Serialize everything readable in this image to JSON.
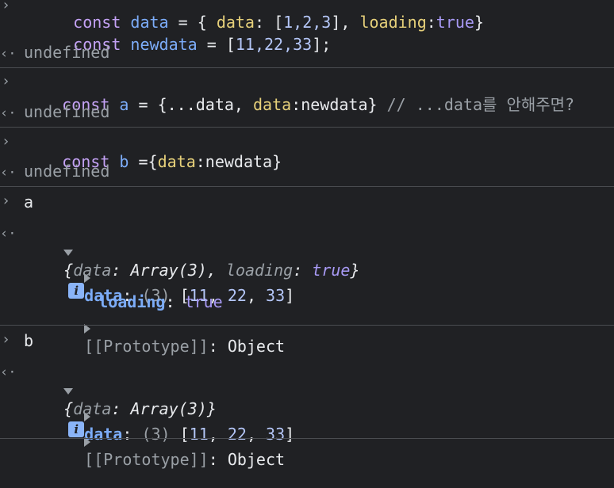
{
  "entries": [
    {
      "kind": "input",
      "cut": true,
      "code": [
        {
          "t": "const ",
          "c": "kw"
        },
        {
          "t": "data",
          "c": "var"
        },
        {
          "t": " = { ",
          "c": "plain"
        },
        {
          "t": "data",
          "c": "prop"
        },
        {
          "t": ": [",
          "c": "plain"
        },
        {
          "t": "1,2,3",
          "c": "num"
        },
        {
          "t": "], ",
          "c": "plain"
        },
        {
          "t": "loading",
          "c": "prop"
        },
        {
          "t": ":",
          "c": "plain"
        },
        {
          "t": "true",
          "c": "bool"
        },
        {
          "t": "}",
          "c": "plain"
        }
      ],
      "code2": [
        {
          "t": "const ",
          "c": "kw"
        },
        {
          "t": "newdata",
          "c": "var"
        },
        {
          "t": " = [",
          "c": "plain"
        },
        {
          "t": "11,22,33",
          "c": "num"
        },
        {
          "t": "];",
          "c": "plain"
        }
      ]
    },
    {
      "kind": "result",
      "text": "undefined"
    },
    {
      "kind": "input",
      "code": [
        {
          "t": "const ",
          "c": "kw"
        },
        {
          "t": "a",
          "c": "var"
        },
        {
          "t": " = {...data, ",
          "c": "plain"
        },
        {
          "t": "data",
          "c": "prop"
        },
        {
          "t": ":newdata} ",
          "c": "plain"
        },
        {
          "t": "// ...data를 안해주면?",
          "c": "cmt"
        }
      ]
    },
    {
      "kind": "result",
      "text": "undefined"
    },
    {
      "kind": "input",
      "code": [
        {
          "t": "const ",
          "c": "kw"
        },
        {
          "t": "b",
          "c": "var"
        },
        {
          "t": " ={",
          "c": "plain"
        },
        {
          "t": "data",
          "c": "prop"
        },
        {
          "t": ":newdata}",
          "c": "plain"
        }
      ]
    },
    {
      "kind": "result",
      "text": "undefined"
    },
    {
      "kind": "input",
      "code": [
        {
          "t": "a",
          "c": "plain"
        }
      ]
    },
    {
      "kind": "object",
      "summary": "{data: Array(3), loading: true}",
      "props": [
        {
          "expandable": true,
          "key": "data",
          "value": "(3) [11, 22, 33]"
        },
        {
          "expandable": false,
          "key": "loading",
          "value": "true"
        },
        {
          "expandable": true,
          "key": "[[Prototype]]",
          "value": "Object"
        }
      ]
    },
    {
      "kind": "input",
      "code": [
        {
          "t": "b",
          "c": "plain"
        }
      ]
    },
    {
      "kind": "object",
      "summary": "{data: Array(3)}",
      "props": [
        {
          "expandable": true,
          "key": "data",
          "value": "(3) [11, 22, 33]"
        },
        {
          "expandable": true,
          "key": "[[Prototype]]",
          "value": "Object"
        }
      ]
    }
  ],
  "icons": {
    "prompt": "chevron-right-icon",
    "result": "return-arrow-icon",
    "info": "info-icon"
  },
  "labels": {
    "obj_a": {
      "data_key": "data",
      "data_len": "(3)",
      "data_vals": "[11, 22, 33]",
      "loading_key": "loading",
      "loading_val": "true",
      "proto_key": "[[Prototype]]",
      "proto_val": "Object",
      "sum_data_key": "data",
      "sum_data_val": "Array(3)",
      "sum_loading_key": "loading",
      "sum_loading_val": "true"
    },
    "obj_b": {
      "data_key": "data",
      "data_len": "(3)",
      "data_vals": "[11, 22, 33]",
      "proto_key": "[[Prototype]]",
      "proto_val": "Object",
      "sum_data_key": "data",
      "sum_data_val": "Array(3)"
    }
  },
  "num_11": "11",
  "num_22": "22",
  "num_33": "33",
  "undefined": "undefined",
  "a_name": "a",
  "b_name": "b",
  "info_glyph": "i"
}
